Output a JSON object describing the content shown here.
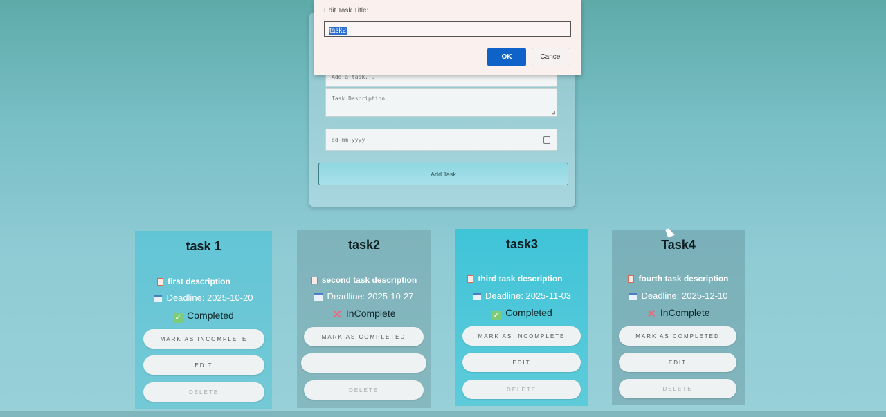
{
  "dialog": {
    "label": "Edit Task Title:",
    "input_value": "task2",
    "ok_label": "OK",
    "cancel_label": "Cancel"
  },
  "form": {
    "title_placeholder": "Add a task...",
    "description_placeholder": "Task Description",
    "date_placeholder": "dd-mm-yyyy",
    "add_button_label": "Add Task"
  },
  "tasks": [
    {
      "title": "task 1",
      "description": "first description",
      "deadline": "Deadline: 2025-10-20",
      "status": "Completed",
      "status_icon": "check-icon",
      "toggle_label": "MARK AS INCOMPLETE",
      "edit_label": "EDIT",
      "delete_label": "DELETE"
    },
    {
      "title": "task2",
      "description": "second task description",
      "deadline": "Deadline: 2025-10-27",
      "status": "InComplete",
      "status_icon": "cross-icon",
      "toggle_label": "MARK AS COMPLETED",
      "edit_label": "",
      "delete_label": "DELETE"
    },
    {
      "title": "task3",
      "description": "third task description",
      "deadline": "Deadline: 2025-11-03",
      "status": "Completed",
      "status_icon": "check-icon",
      "toggle_label": "MARK AS INCOMPLETE",
      "edit_label": "EDIT",
      "delete_label": "DELETE"
    },
    {
      "title": "Task4",
      "description": "fourth task description",
      "deadline": "Deadline: 2025-12-10",
      "status": "InComplete",
      "status_icon": "cross-icon",
      "toggle_label": "MARK AS COMPLETED",
      "edit_label": "EDIT",
      "delete_label": "DELETE"
    }
  ],
  "colors": {
    "accent_ok": "#0f63c8",
    "completed_check": "#7ecb78",
    "incomplete_cross": "#e86b7b"
  }
}
